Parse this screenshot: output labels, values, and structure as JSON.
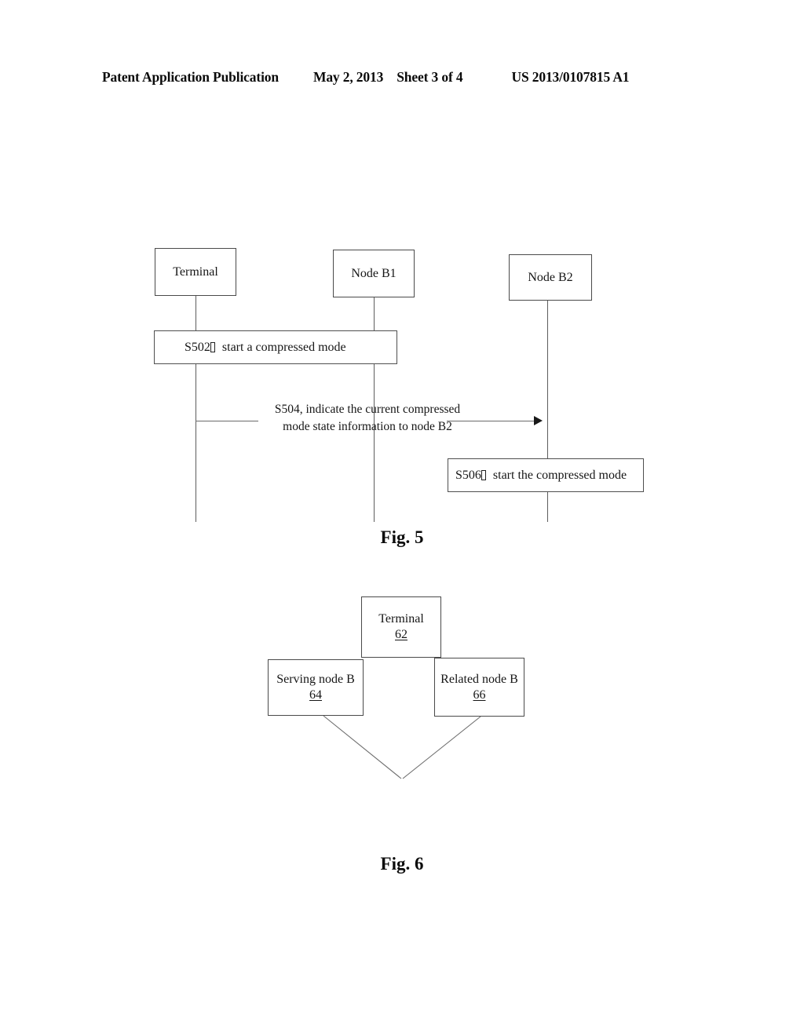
{
  "header": {
    "publication": "Patent Application Publication",
    "date": "May 2, 2013",
    "sheet": "Sheet 3 of 4",
    "patent_number": "US 2013/0107815 A1"
  },
  "figure5": {
    "caption": "Fig. 5",
    "type": "sequence-diagram",
    "lifelines": [
      {
        "id": "terminal",
        "label": "Terminal"
      },
      {
        "id": "node_b1",
        "label": "Node B1"
      },
      {
        "id": "node_b2",
        "label": "Node B2"
      }
    ],
    "steps": [
      {
        "id": "S502",
        "step_label": "S502",
        "text": "start a compressed mode",
        "kind": "self-box",
        "spans": [
          "terminal",
          "node_b1"
        ]
      },
      {
        "id": "S504",
        "line1": "S504, indicate the current compressed",
        "line2": "mode state information to node B2",
        "kind": "arrow",
        "from": "terminal",
        "to": "node_b2"
      },
      {
        "id": "S506",
        "step_label": "S506",
        "text": "start the compressed mode",
        "kind": "self-box",
        "spans": [
          "node_b2"
        ]
      }
    ]
  },
  "figure6": {
    "caption": "Fig. 6",
    "type": "block-diagram",
    "blocks": [
      {
        "id": "serving_node_b",
        "label": "Serving node B",
        "ref": "64"
      },
      {
        "id": "related_node_b",
        "label": "Related node B",
        "ref": "66"
      },
      {
        "id": "terminal",
        "label": "Terminal",
        "ref": "62"
      }
    ],
    "connections": [
      {
        "from": "serving_node_b",
        "to": "terminal"
      },
      {
        "from": "related_node_b",
        "to": "terminal"
      }
    ]
  }
}
